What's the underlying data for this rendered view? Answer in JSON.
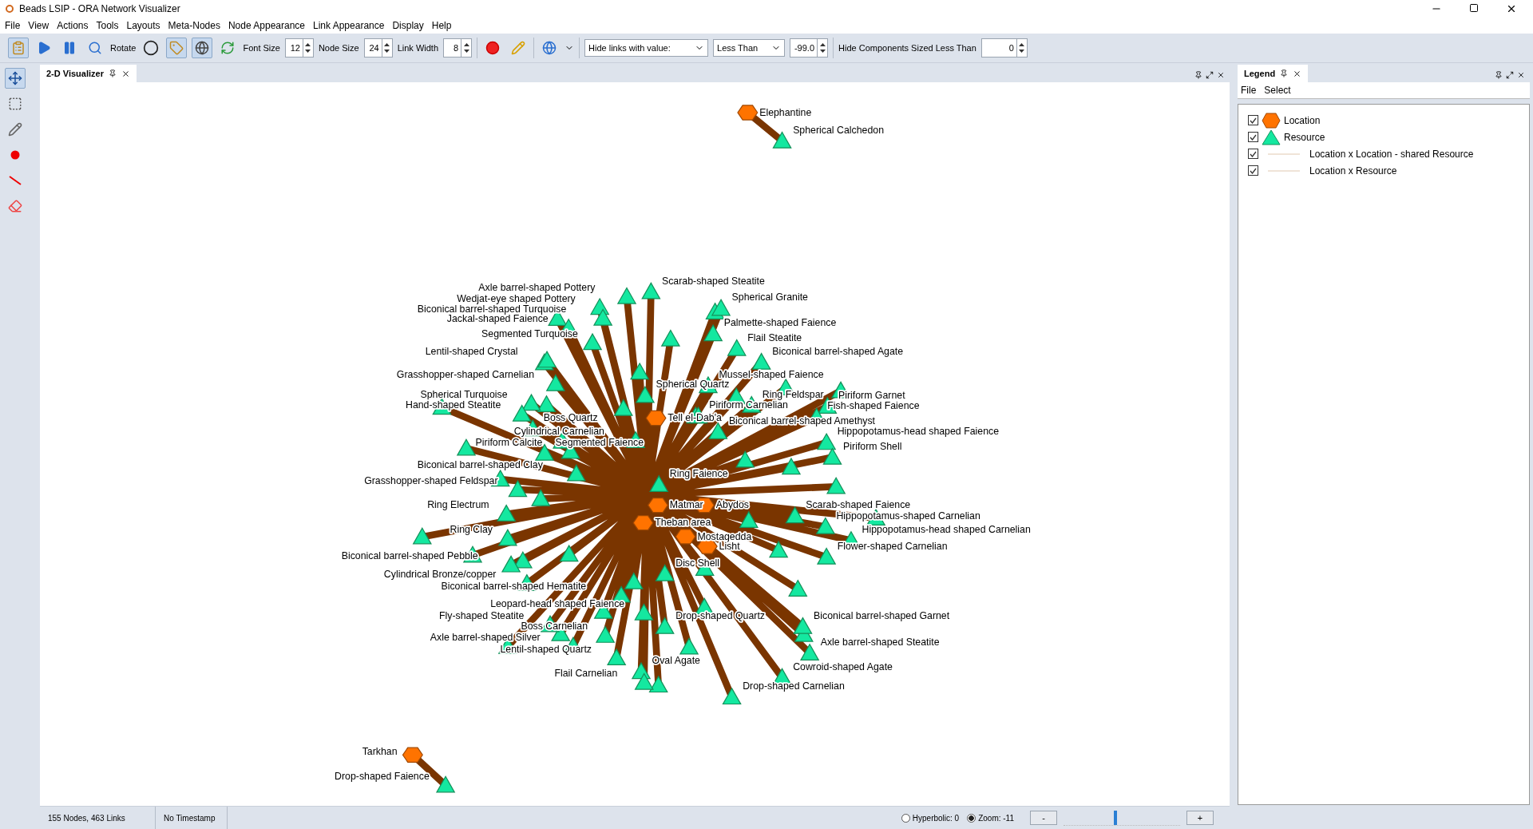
{
  "window": {
    "title": "Beads LSIP - ORA Network Visualizer"
  },
  "menu": [
    "File",
    "View",
    "Actions",
    "Tools",
    "Layouts",
    "Meta-Nodes",
    "Node Appearance",
    "Link Appearance",
    "Display",
    "Help"
  ],
  "toolbar": {
    "rotate_label": "Rotate",
    "font_size": {
      "label": "Font Size",
      "value": "12"
    },
    "node_size": {
      "label": "Node Size",
      "value": "24"
    },
    "link_width": {
      "label": "Link Width",
      "value": "8"
    },
    "link_filter": "Hide links with value:",
    "comparison": "Less Than",
    "threshold": "-99.0",
    "hide_components": {
      "label": "Hide Components Sized Less Than",
      "value": "0"
    }
  },
  "visualizer_tab": {
    "title": "2-D Visualizer"
  },
  "graph": {
    "nodes": [
      {
        "label": "Elephantine",
        "kind": "location"
      },
      {
        "label": "Spherical Calchedon",
        "kind": "resource"
      },
      {
        "label": "Scarab-shaped Steatite",
        "kind": "resource"
      },
      {
        "label": "Axle barrel-shaped Pottery",
        "kind": "resource"
      },
      {
        "label": "Wedjat-eye shaped Pottery",
        "kind": "resource"
      },
      {
        "label": "Spherical Granite",
        "kind": "resource"
      },
      {
        "label": "Biconical barrel-shaped Turquoise",
        "kind": "resource"
      },
      {
        "label": "Jackal-shaped Faience",
        "kind": "resource"
      },
      {
        "label": "Palmette-shaped Faience",
        "kind": "resource"
      },
      {
        "label": "Segmented Turquoise",
        "kind": "resource"
      },
      {
        "label": "Flail Steatite",
        "kind": "resource"
      },
      {
        "label": "Lentil-shaped Crystal",
        "kind": "resource"
      },
      {
        "label": "Biconical barrel-shaped Agate",
        "kind": "resource"
      },
      {
        "label": "Grasshopper-shaped Carnelian",
        "kind": "resource"
      },
      {
        "label": "Mussel-shaped Faience",
        "kind": "resource"
      },
      {
        "label": "Spherical Quartz",
        "kind": "resource"
      },
      {
        "label": "Spherical Turquoise",
        "kind": "resource"
      },
      {
        "label": "Ring Feldspar",
        "kind": "resource"
      },
      {
        "label": "Piriform Garnet",
        "kind": "resource"
      },
      {
        "label": "Hand-shaped Steatite",
        "kind": "resource"
      },
      {
        "label": "Piriform Carnelian",
        "kind": "resource"
      },
      {
        "label": "Fish-shaped Faience",
        "kind": "resource"
      },
      {
        "label": "Boss Quartz",
        "kind": "resource"
      },
      {
        "label": "Tell el-Dab'a",
        "kind": "location"
      },
      {
        "label": "Biconical barrel-shaped Amethyst",
        "kind": "resource"
      },
      {
        "label": "Cylindrical Carnelian",
        "kind": "resource"
      },
      {
        "label": "Hippopotamus-head shaped Faience",
        "kind": "resource"
      },
      {
        "label": "Piriform Calcite",
        "kind": "resource"
      },
      {
        "label": "Segmented Faience",
        "kind": "resource"
      },
      {
        "label": "Piriform Shell",
        "kind": "resource"
      },
      {
        "label": "Biconical barrel-shaped Clay",
        "kind": "resource"
      },
      {
        "label": "Ring Faience",
        "kind": "resource"
      },
      {
        "label": "Grasshopper-shaped Feldspar",
        "kind": "resource"
      },
      {
        "label": "Ring Electrum",
        "kind": "resource"
      },
      {
        "label": "Matmar",
        "kind": "location"
      },
      {
        "label": "Abydos",
        "kind": "location"
      },
      {
        "label": "Scarab-shaped Faience",
        "kind": "resource"
      },
      {
        "label": "Hippopotamus-shaped Carnelian",
        "kind": "resource"
      },
      {
        "label": "Theban area",
        "kind": "location"
      },
      {
        "label": "Ring Clay",
        "kind": "resource"
      },
      {
        "label": "Hippopotamus-head shaped Carnelian",
        "kind": "resource"
      },
      {
        "label": "Mostagedda",
        "kind": "location"
      },
      {
        "label": "Lisht",
        "kind": "location"
      },
      {
        "label": "Flower-shaped Carnelian",
        "kind": "resource"
      },
      {
        "label": "Biconical barrel-shaped Pebble",
        "kind": "resource"
      },
      {
        "label": "Disc Shell",
        "kind": "resource"
      },
      {
        "label": "Cylindrical Bronze/copper",
        "kind": "resource"
      },
      {
        "label": "Biconical barrel-shaped Hematite",
        "kind": "resource"
      },
      {
        "label": "Leopard-head shaped Faience",
        "kind": "resource"
      },
      {
        "label": "Fly-shaped Steatite",
        "kind": "resource"
      },
      {
        "label": "Drop-shaped Quartz",
        "kind": "resource"
      },
      {
        "label": "Biconical barrel-shaped Garnet",
        "kind": "resource"
      },
      {
        "label": "Boss Carnelian",
        "kind": "resource"
      },
      {
        "label": "Axle barrel-shaped Silver",
        "kind": "resource"
      },
      {
        "label": "Axle barrel-shaped Steatite",
        "kind": "resource"
      },
      {
        "label": "Lentil-shaped Quartz",
        "kind": "resource"
      },
      {
        "label": "Oval Agate",
        "kind": "resource"
      },
      {
        "label": "Cowroid-shaped Agate",
        "kind": "resource"
      },
      {
        "label": "Flail Carnelian",
        "kind": "resource"
      },
      {
        "label": "Drop-shaped Carnelian",
        "kind": "resource"
      },
      {
        "label": "Tarkhan",
        "kind": "location"
      },
      {
        "label": "Drop-shaped Faience",
        "kind": "resource"
      }
    ]
  },
  "legend": {
    "title": "Legend",
    "menu": [
      "File",
      "Select"
    ],
    "items": [
      {
        "kind": "location",
        "label": "Location",
        "checked": true
      },
      {
        "kind": "resource",
        "label": "Resource",
        "checked": true
      },
      {
        "kind": "link",
        "label": "Location x Location - shared Resource",
        "checked": true
      },
      {
        "kind": "link",
        "label": "Location x Resource",
        "checked": true
      }
    ]
  },
  "status_bar": {
    "counts": "155 Nodes, 463 Links",
    "timestamp": "No Timestamp",
    "hyperbolic": {
      "label": "Hyperbolic: 0",
      "selected": false
    },
    "zoom": {
      "label": "Zoom: -11",
      "selected": true
    },
    "zoom_out": "-",
    "zoom_in": "+",
    "zoom_level": {
      "level": 0.43
    }
  }
}
